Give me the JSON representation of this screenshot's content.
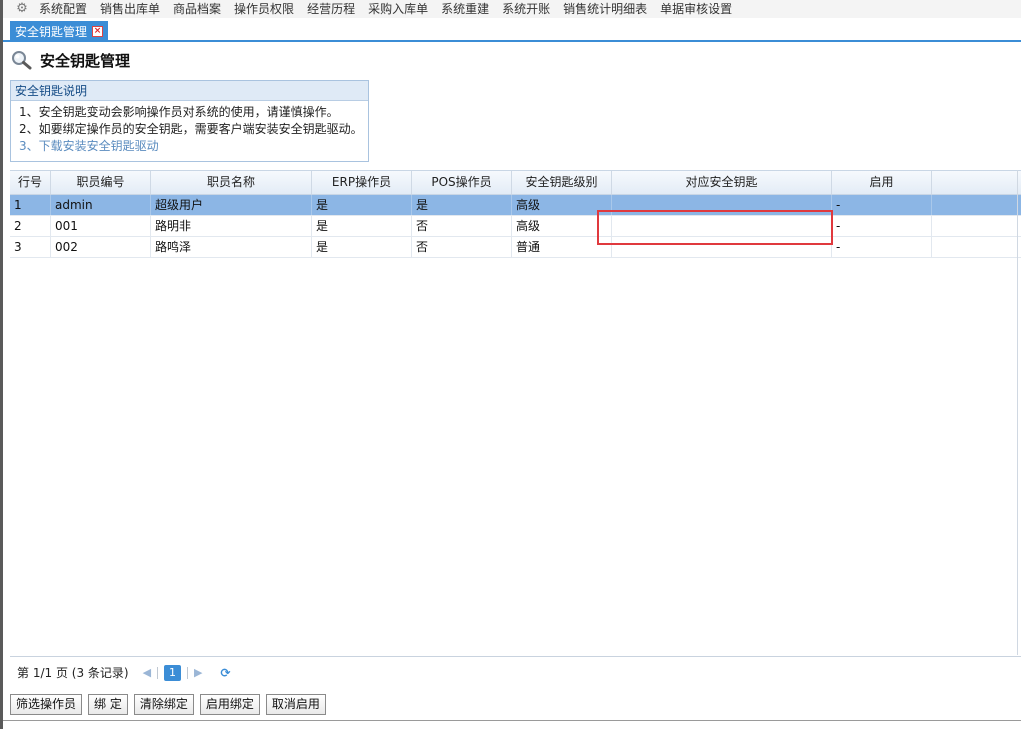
{
  "menu": {
    "items": [
      "系统配置",
      "销售出库单",
      "商品档案",
      "操作员权限",
      "经营历程",
      "采购入库单",
      "系统重建",
      "系统开账",
      "销售统计明细表",
      "单据审核设置"
    ]
  },
  "tab": {
    "label": "安全钥匙管理",
    "close": "×"
  },
  "page": {
    "title": "安全钥匙管理"
  },
  "note": {
    "heading": "安全钥匙说明",
    "line1": "1、安全钥匙变动会影响操作员对系统的使用，请谨慎操作。",
    "line2": "2、如要绑定操作员的安全钥匙，需要客户端安装安全钥匙驱动。",
    "line3": "3、下载安装安全钥匙驱动"
  },
  "grid": {
    "columns": [
      "行号",
      "职员编号",
      "职员名称",
      "ERP操作员",
      "POS操作员",
      "安全钥匙级别",
      "对应安全钥匙",
      "启用",
      ""
    ],
    "rows": [
      [
        "1",
        "admin",
        "超级用户",
        "是",
        "是",
        "高级",
        "",
        "-",
        ""
      ],
      [
        "2",
        "001",
        "路明非",
        "是",
        "否",
        "高级",
        "",
        "-",
        ""
      ],
      [
        "3",
        "002",
        "路鸣泽",
        "是",
        "否",
        "普通",
        "",
        "-",
        ""
      ]
    ]
  },
  "pager": {
    "summary": "第 1/1 页 (3 条记录)",
    "current": "1",
    "prev": "◀",
    "next": "▶",
    "refresh": "⟳"
  },
  "buttons": {
    "filter": "筛选操作员",
    "bind": "绑 定",
    "clear": "清除绑定",
    "enable": "启用绑定",
    "cancel": "取消启用"
  },
  "colors": {
    "accent": "#3b8dd6",
    "selected_row": "#8cb6e5",
    "highlight_box": "#e0393e"
  }
}
